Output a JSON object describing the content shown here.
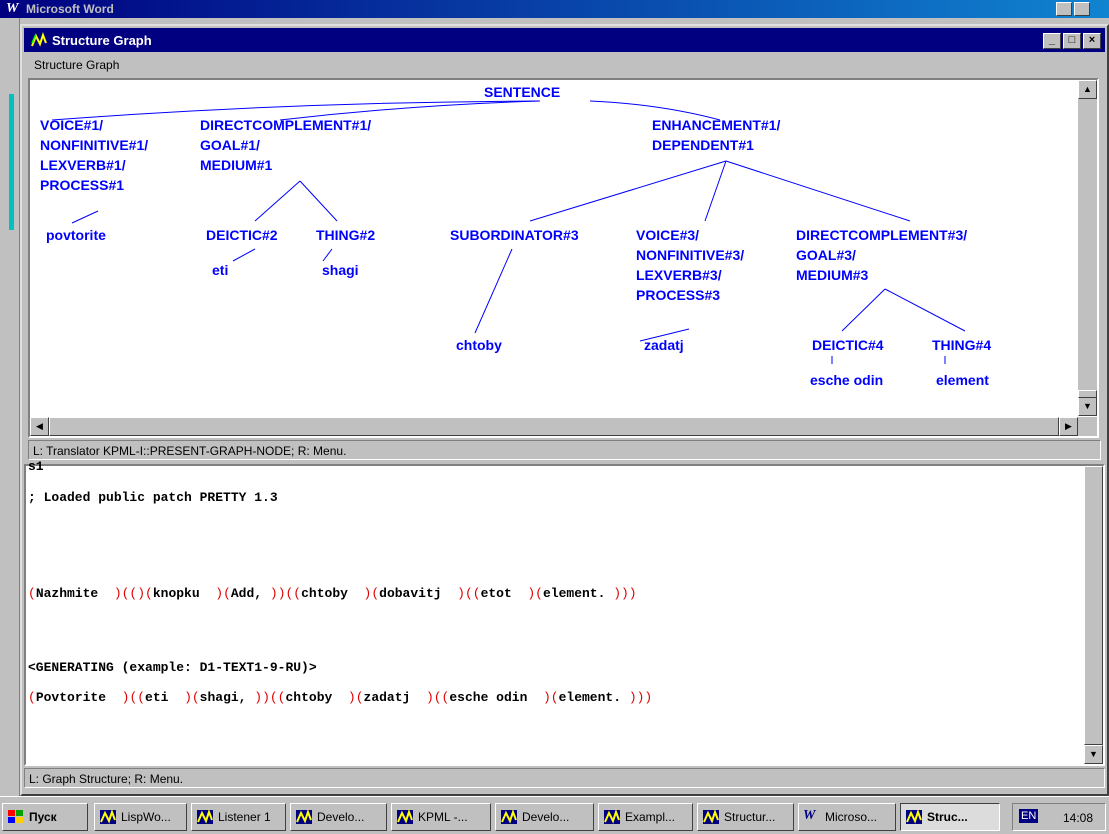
{
  "background_window": {
    "title": "Microsoft Word"
  },
  "window": {
    "title": "Structure Graph",
    "menu": [
      "Structure Graph"
    ],
    "controls": {
      "minimize": "_",
      "maximize": "□",
      "close": "×"
    }
  },
  "graph": {
    "nodes": {
      "sentence": "SENTENCE",
      "voice1": "VOICE#1/\nNONFINITIVE#1/\nLEXVERB#1/\nPROCESS#1",
      "dcomp1": "DIRECTCOMPLEMENT#1/\nGOAL#1/\nMEDIUM#1",
      "enh1": "ENHANCEMENT#1/\nDEPENDENT#1",
      "povtorite": "povtorite",
      "deictic2": "DEICTIC#2",
      "thing2": "THING#2",
      "eti": "eti",
      "shagi": "shagi",
      "sub3": "SUBORDINATOR#3",
      "voice3": "VOICE#3/\nNONFINITIVE#3/\nLEXVERB#3/\nPROCESS#3",
      "dcomp3": "DIRECTCOMPLEMENT#3/\nGOAL#3/\nMEDIUM#3",
      "chtoby": "chtoby",
      "zadatj": "zadatj",
      "deictic4": "DEICTIC#4",
      "thing4": "THING#4",
      "esche_odin": "esche odin",
      "element": "element"
    }
  },
  "status_top": "L: Translator KPML-I::PRESENT-GRAPH-NODE; R: Menu.",
  "listener": {
    "line0": "s1",
    "line1": "; Loaded public patch PRETTY 1.3",
    "line2": [
      "(",
      "Nazhmite  ",
      ")(()(",
      "knopku  ",
      ")(",
      "Add, ",
      "))((",
      "chtoby  ",
      ")(",
      "dobavitj  ",
      ")((",
      "etot  ",
      ")(",
      "element. ",
      ")))"
    ],
    "line3": "<GENERATING (example: D1-TEXT1-9-RU)>",
    "line4": [
      "(",
      "Povtorite  ",
      ")((",
      "eti  ",
      ")(",
      "shagi, ",
      "))((",
      "chtoby  ",
      ")(",
      "zadatj  ",
      ")((",
      "esche odin  ",
      ")(",
      "element. ",
      ")))"
    ]
  },
  "status_bottom": "L: Graph Structure; R: Menu.",
  "taskbar": {
    "start": "Пуск",
    "items": [
      "LispWo...",
      "Listener 1",
      "Develo...",
      "KPML -...",
      "Develo...",
      "Exampl...",
      "Structur...",
      "Microso...",
      "Struc..."
    ],
    "lang": "EN",
    "clock": "14:08"
  }
}
